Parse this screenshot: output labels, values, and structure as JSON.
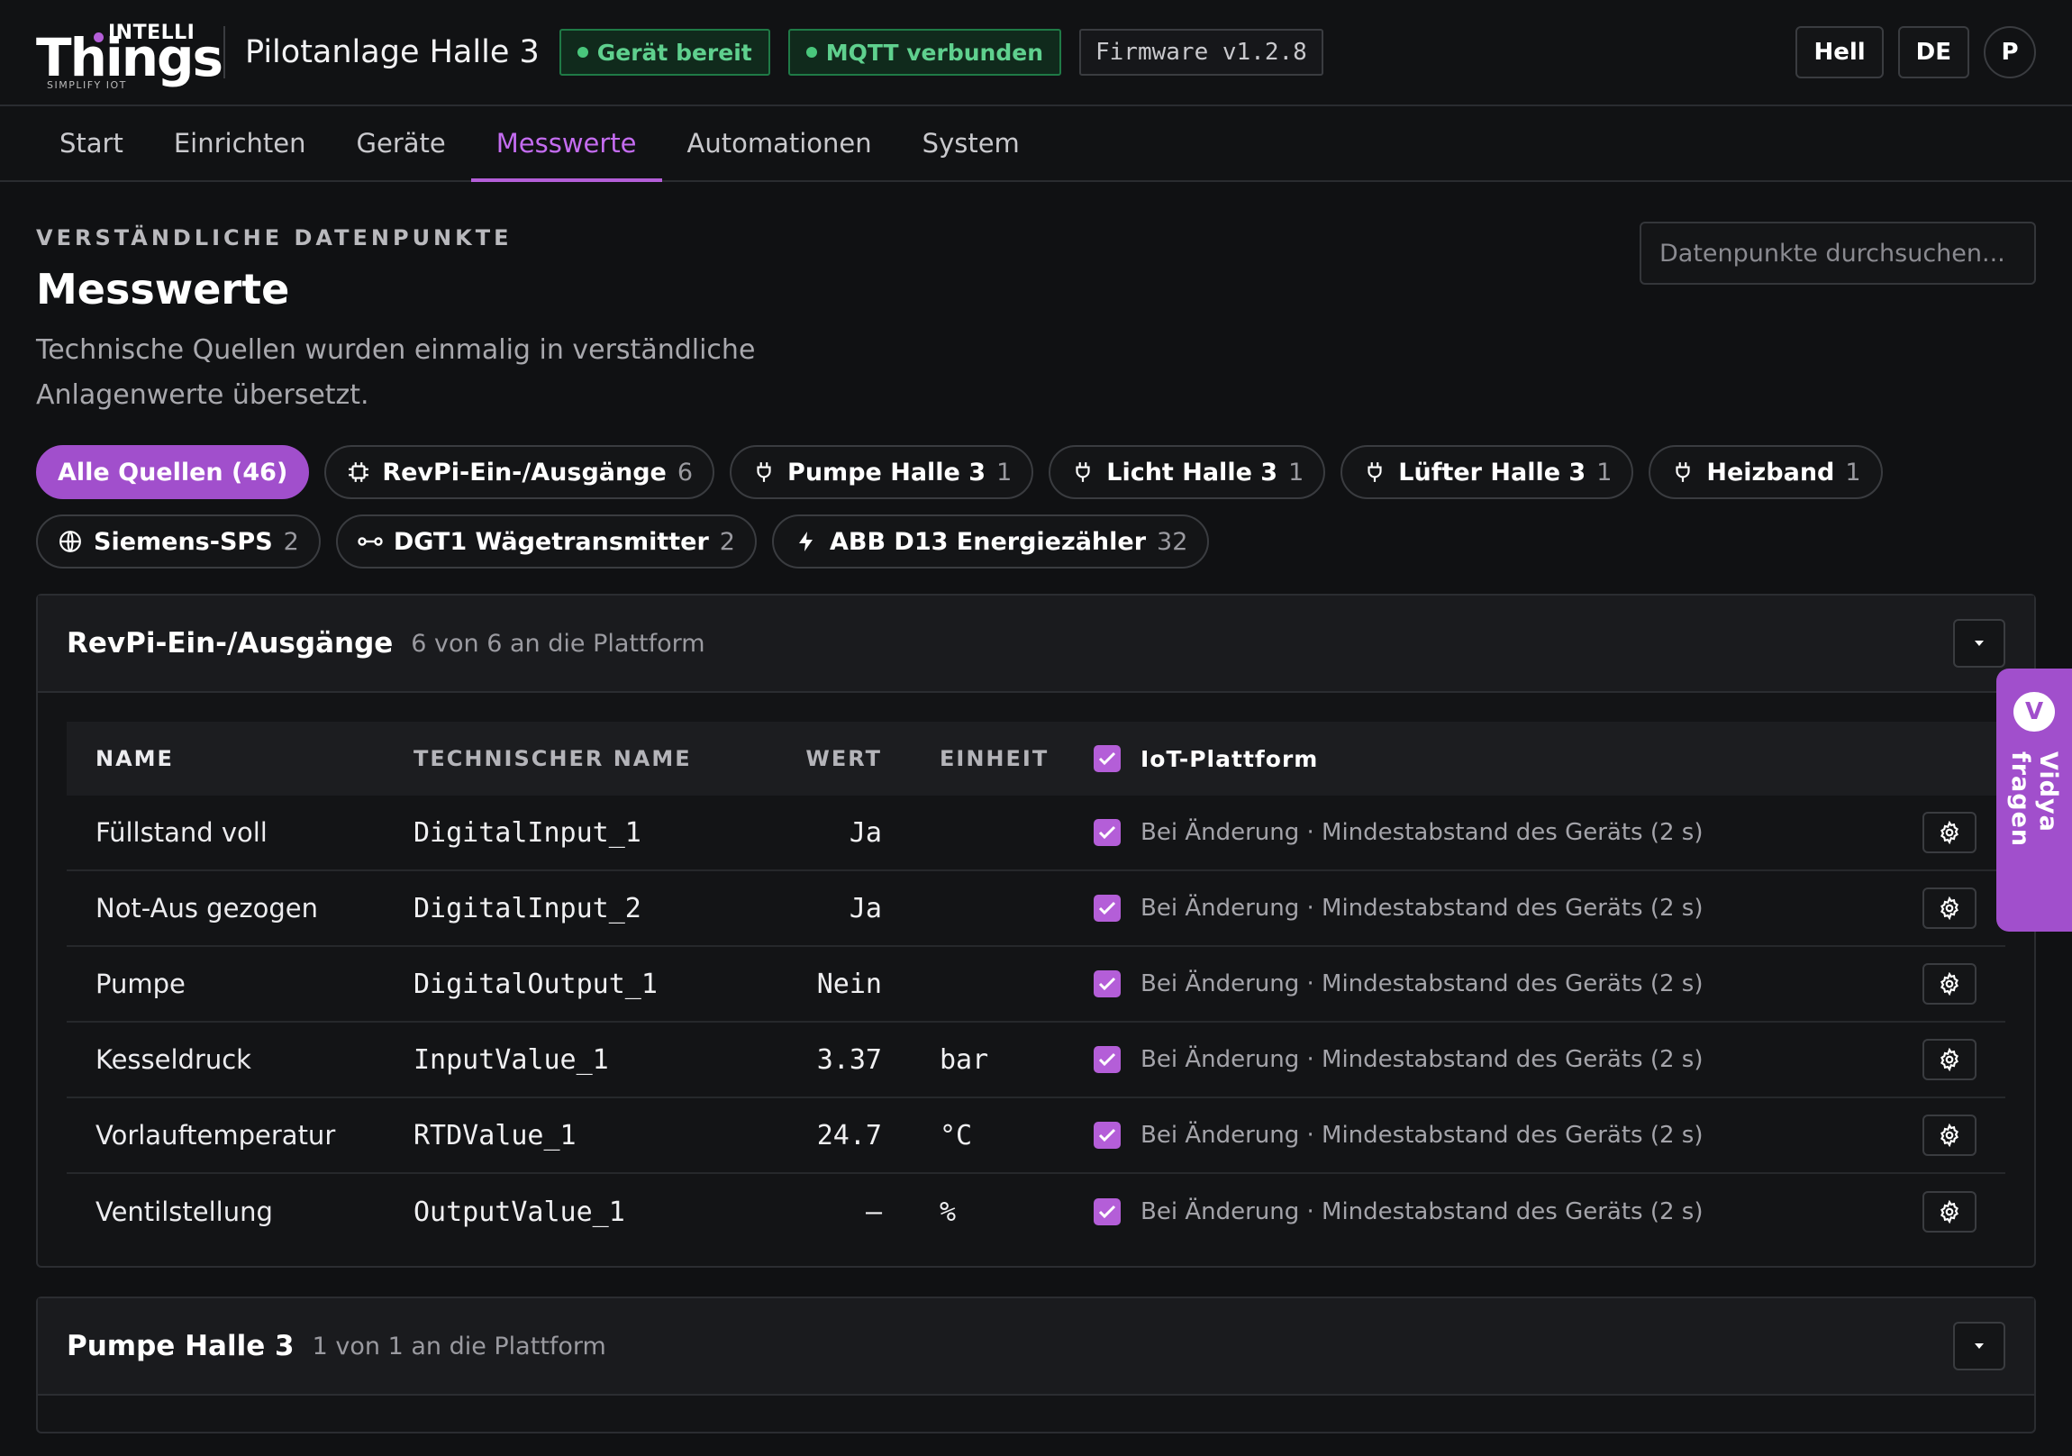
{
  "brand": {
    "intelli": "INTELLI",
    "things": "Things",
    "tagline": "SIMPLIFY IOT"
  },
  "header": {
    "site_title": "Pilotanlage Halle 3",
    "status_device": "Gerät bereit",
    "status_mqtt": "MQTT verbunden",
    "firmware": "Firmware v1.2.8",
    "theme_button": "Hell",
    "lang_button": "DE",
    "avatar_initial": "P"
  },
  "nav": {
    "items": [
      {
        "label": "Start"
      },
      {
        "label": "Einrichten"
      },
      {
        "label": "Geräte"
      },
      {
        "label": "Messwerte"
      },
      {
        "label": "Automationen"
      },
      {
        "label": "System"
      }
    ],
    "active": "Messwerte"
  },
  "page": {
    "eyebrow": "VERSTÄNDLICHE DATENPUNKTE",
    "title": "Messwerte",
    "description": "Technische Quellen wurden einmalig in verständliche Anlagenwerte übersetzt.",
    "search_placeholder": "Datenpunkte durchsuchen..."
  },
  "chips": [
    {
      "label": "Alle Quellen (46)",
      "count": "",
      "icon": "none",
      "active": true
    },
    {
      "label": "RevPi-Ein-/Ausgänge",
      "count": "6",
      "icon": "chip-icon"
    },
    {
      "label": "Pumpe Halle 3",
      "count": "1",
      "icon": "plug-icon"
    },
    {
      "label": "Licht Halle 3",
      "count": "1",
      "icon": "plug-icon"
    },
    {
      "label": "Lüfter Halle 3",
      "count": "1",
      "icon": "plug-icon"
    },
    {
      "label": "Heizband",
      "count": "1",
      "icon": "plug-icon"
    },
    {
      "label": "Siemens-SPS",
      "count": "2",
      "icon": "globe-icon"
    },
    {
      "label": "DGT1 Wägetransmitter",
      "count": "2",
      "icon": "link-icon"
    },
    {
      "label": "ABB D13 Energiezähler",
      "count": "32",
      "icon": "bolt-icon"
    }
  ],
  "table_headers": {
    "name": "NAME",
    "tech": "TECHNISCHER NAME",
    "value": "WERT",
    "unit": "EINHEIT",
    "platform": "IoT-Plattform"
  },
  "groups": [
    {
      "title": "RevPi-Ein-/Ausgänge",
      "subtitle": "6 von 6 an die Plattform",
      "rows": [
        {
          "name": "Füllstand voll",
          "tech": "DigitalInput_1",
          "value": "Ja",
          "unit": "",
          "rule": "Bei Änderung · Mindestabstand des Geräts (2 s)"
        },
        {
          "name": "Not-Aus gezogen",
          "tech": "DigitalInput_2",
          "value": "Ja",
          "unit": "",
          "rule": "Bei Änderung · Mindestabstand des Geräts (2 s)"
        },
        {
          "name": "Pumpe",
          "tech": "DigitalOutput_1",
          "value": "Nein",
          "unit": "",
          "rule": "Bei Änderung · Mindestabstand des Geräts (2 s)"
        },
        {
          "name": "Kesseldruck",
          "tech": "InputValue_1",
          "value": "3.37",
          "unit": "bar",
          "rule": "Bei Änderung · Mindestabstand des Geräts (2 s)"
        },
        {
          "name": "Vorlauftemperatur",
          "tech": "RTDValue_1",
          "value": "24.7",
          "unit": "°C",
          "rule": "Bei Änderung · Mindestabstand des Geräts (2 s)"
        },
        {
          "name": "Ventilstellung",
          "tech": "OutputValue_1",
          "value": "–",
          "unit": "%",
          "rule": "Bei Änderung · Mindestabstand des Geräts (2 s)"
        }
      ]
    },
    {
      "title": "Pumpe Halle 3",
      "subtitle": "1 von 1 an die Plattform",
      "rows": []
    }
  ],
  "assistant": {
    "badge": "V",
    "label": "Vidya fragen"
  },
  "colors": {
    "accent": "#b45ed8",
    "status_green": "#5fd08e",
    "background": "#101113"
  }
}
